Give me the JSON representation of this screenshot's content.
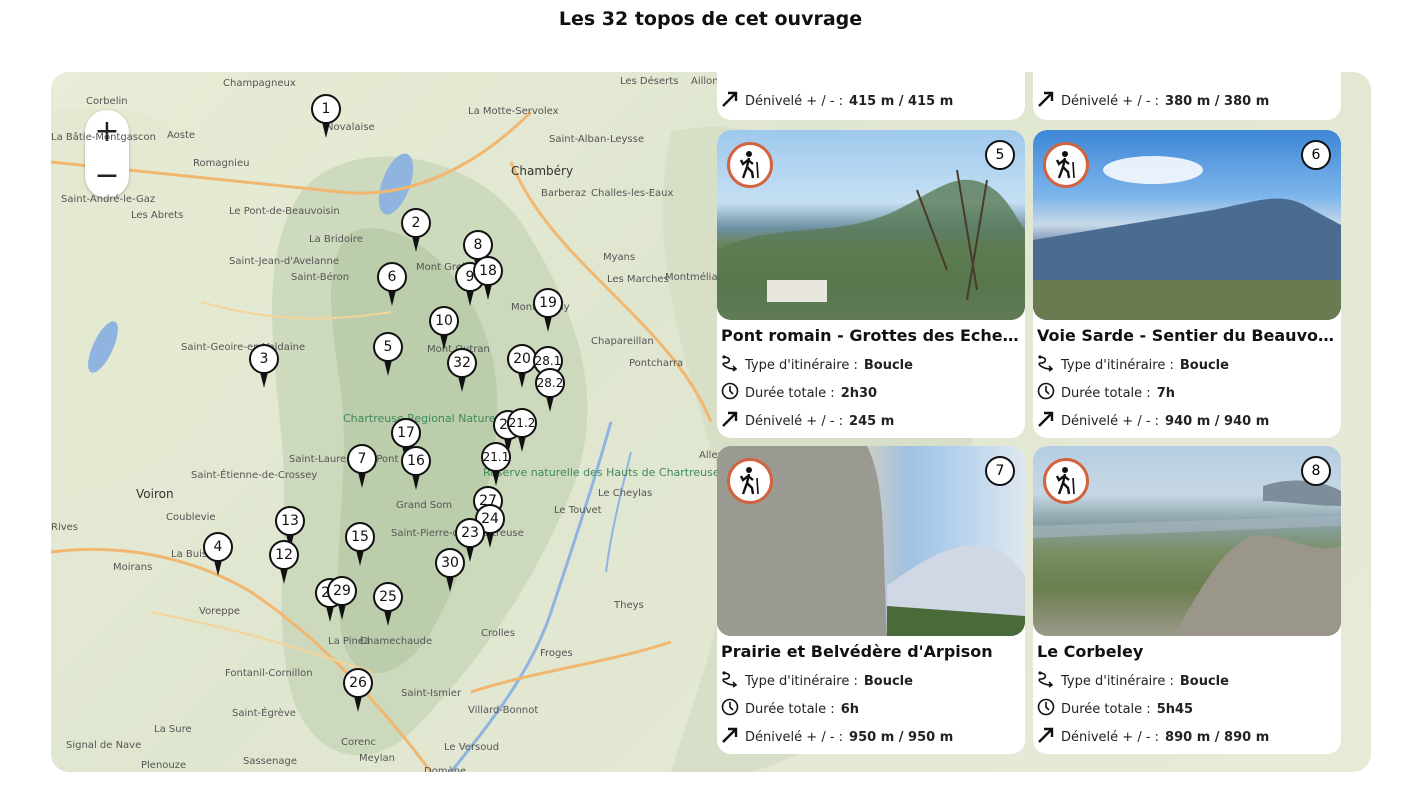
{
  "page": {
    "title": "Les 32 topos de cet ouvrage"
  },
  "map": {
    "zoom_in": "+",
    "zoom_out": "−",
    "places": [
      {
        "label": "Champagneux",
        "cls": ""
      },
      {
        "label": "Corbelin",
        "cls": ""
      },
      {
        "label": "Aoste",
        "cls": ""
      },
      {
        "label": "La Bâtie-Montgascon",
        "cls": ""
      },
      {
        "label": "Romagnieu",
        "cls": ""
      },
      {
        "label": "Novalaise",
        "cls": ""
      },
      {
        "label": "La Motte-Servolex",
        "cls": ""
      },
      {
        "label": "Les Déserts",
        "cls": ""
      },
      {
        "label": "Aillon-le-Jeune",
        "cls": ""
      },
      {
        "label": "Saint-Alban-Leysse",
        "cls": ""
      },
      {
        "label": "Chambéry",
        "cls": "big"
      },
      {
        "label": "Barberaz",
        "cls": ""
      },
      {
        "label": "Challes-les-Eaux",
        "cls": ""
      },
      {
        "label": "Saint-André-le-Gaz",
        "cls": ""
      },
      {
        "label": "Les Abrets",
        "cls": ""
      },
      {
        "label": "Le Pont-de-Beauvoisin",
        "cls": ""
      },
      {
        "label": "La Bridoire",
        "cls": ""
      },
      {
        "label": "Saint-Jean-d'Avelanne",
        "cls": ""
      },
      {
        "label": "Saint-Béron",
        "cls": ""
      },
      {
        "label": "Myans",
        "cls": ""
      },
      {
        "label": "Les Marches",
        "cls": ""
      },
      {
        "label": "Montmélian",
        "cls": ""
      },
      {
        "label": "Mont Joigny",
        "cls": ""
      },
      {
        "label": "Mont Outran",
        "cls": ""
      },
      {
        "label": "Mont Grelle",
        "cls": ""
      },
      {
        "label": "Saint-Geoire-en-Valdaine",
        "cls": ""
      },
      {
        "label": "Chapareillan",
        "cls": ""
      },
      {
        "label": "Pontcharra",
        "cls": ""
      },
      {
        "label": "Chartreuse Regional Nature Park",
        "cls": "green"
      },
      {
        "label": "Réserve naturelle des Hauts de Chartreuse",
        "cls": "green"
      },
      {
        "label": "Saint-Laurent-du-Pont",
        "cls": ""
      },
      {
        "label": "Saint-Étienne-de-Crossey",
        "cls": ""
      },
      {
        "label": "Voiron",
        "cls": "big"
      },
      {
        "label": "Coublevie",
        "cls": ""
      },
      {
        "label": "Grand Som",
        "cls": ""
      },
      {
        "label": "Saint-Pierre-de-Chartreuse",
        "cls": ""
      },
      {
        "label": "Le Touvet",
        "cls": ""
      },
      {
        "label": "Le Cheylas",
        "cls": ""
      },
      {
        "label": "Rives",
        "cls": ""
      },
      {
        "label": "La Buisse",
        "cls": ""
      },
      {
        "label": "Moirans",
        "cls": ""
      },
      {
        "label": "Voreppe",
        "cls": ""
      },
      {
        "label": "Theys",
        "cls": ""
      },
      {
        "label": "Crolles",
        "cls": ""
      },
      {
        "label": "La Pinéa",
        "cls": ""
      },
      {
        "label": "Chamechaude",
        "cls": ""
      },
      {
        "label": "Froges",
        "cls": ""
      },
      {
        "label": "Fontanil-Cornillon",
        "cls": ""
      },
      {
        "label": "Saint-Ismier",
        "cls": ""
      },
      {
        "label": "Villard-Bonnot",
        "cls": ""
      },
      {
        "label": "Saint-Égrève",
        "cls": ""
      },
      {
        "label": "La Sure",
        "cls": ""
      },
      {
        "label": "Signal de Nave",
        "cls": ""
      },
      {
        "label": "Corenc",
        "cls": ""
      },
      {
        "label": "Le Versoud",
        "cls": ""
      },
      {
        "label": "Meylan",
        "cls": ""
      },
      {
        "label": "Domène",
        "cls": ""
      },
      {
        "label": "Sassenage",
        "cls": ""
      },
      {
        "label": "Plenouze",
        "cls": ""
      },
      {
        "label": "Allevard",
        "cls": ""
      }
    ],
    "pins": [
      "1",
      "2",
      "8",
      "6",
      "9",
      "18",
      "19",
      "10",
      "5",
      "32",
      "20",
      "28.1",
      "28.2",
      "3",
      "21",
      "21.2",
      "17",
      "16",
      "21.1",
      "7",
      "13",
      "27",
      "24",
      "23",
      "15",
      "4",
      "12",
      "30",
      "22",
      "29",
      "25",
      "26"
    ]
  },
  "cards": {
    "top_left": {
      "label": "Dénivelé + / - : ",
      "value": "415 m / 415 m"
    },
    "top_right": {
      "label": "Dénivelé + / - : ",
      "value": "380 m / 380 m"
    },
    "items": [
      {
        "number": "5",
        "title": "Pont romain - Grottes des Echelles - ...",
        "type_label": "Type d'itinéraire : ",
        "type_value": "Boucle",
        "duration_label": "Durée totale : ",
        "duration_value": "2h30",
        "elev_label": "Dénivelé + / - : ",
        "elev_value": "245 m"
      },
      {
        "number": "6",
        "title": "Voie Sarde - Sentier du Beauvoir - Mo...",
        "type_label": "Type d'itinéraire : ",
        "type_value": "Boucle",
        "duration_label": "Durée totale : ",
        "duration_value": "7h",
        "elev_label": "Dénivelé + / - : ",
        "elev_value": "940 m / 940 m"
      },
      {
        "number": "7",
        "title": "Prairie et Belvédère d'Arpison",
        "type_label": "Type d'itinéraire : ",
        "type_value": "Boucle",
        "duration_label": "Durée totale : ",
        "duration_value": "6h",
        "elev_label": "Dénivelé + / - : ",
        "elev_value": "950 m / 950 m"
      },
      {
        "number": "8",
        "title": "Le Corbeley",
        "type_label": "Type d'itinéraire : ",
        "type_value": "Boucle",
        "duration_label": "Durée totale : ",
        "duration_value": "5h45",
        "elev_label": "Dénivelé + / - : ",
        "elev_value": "890 m / 890 m"
      }
    ]
  }
}
